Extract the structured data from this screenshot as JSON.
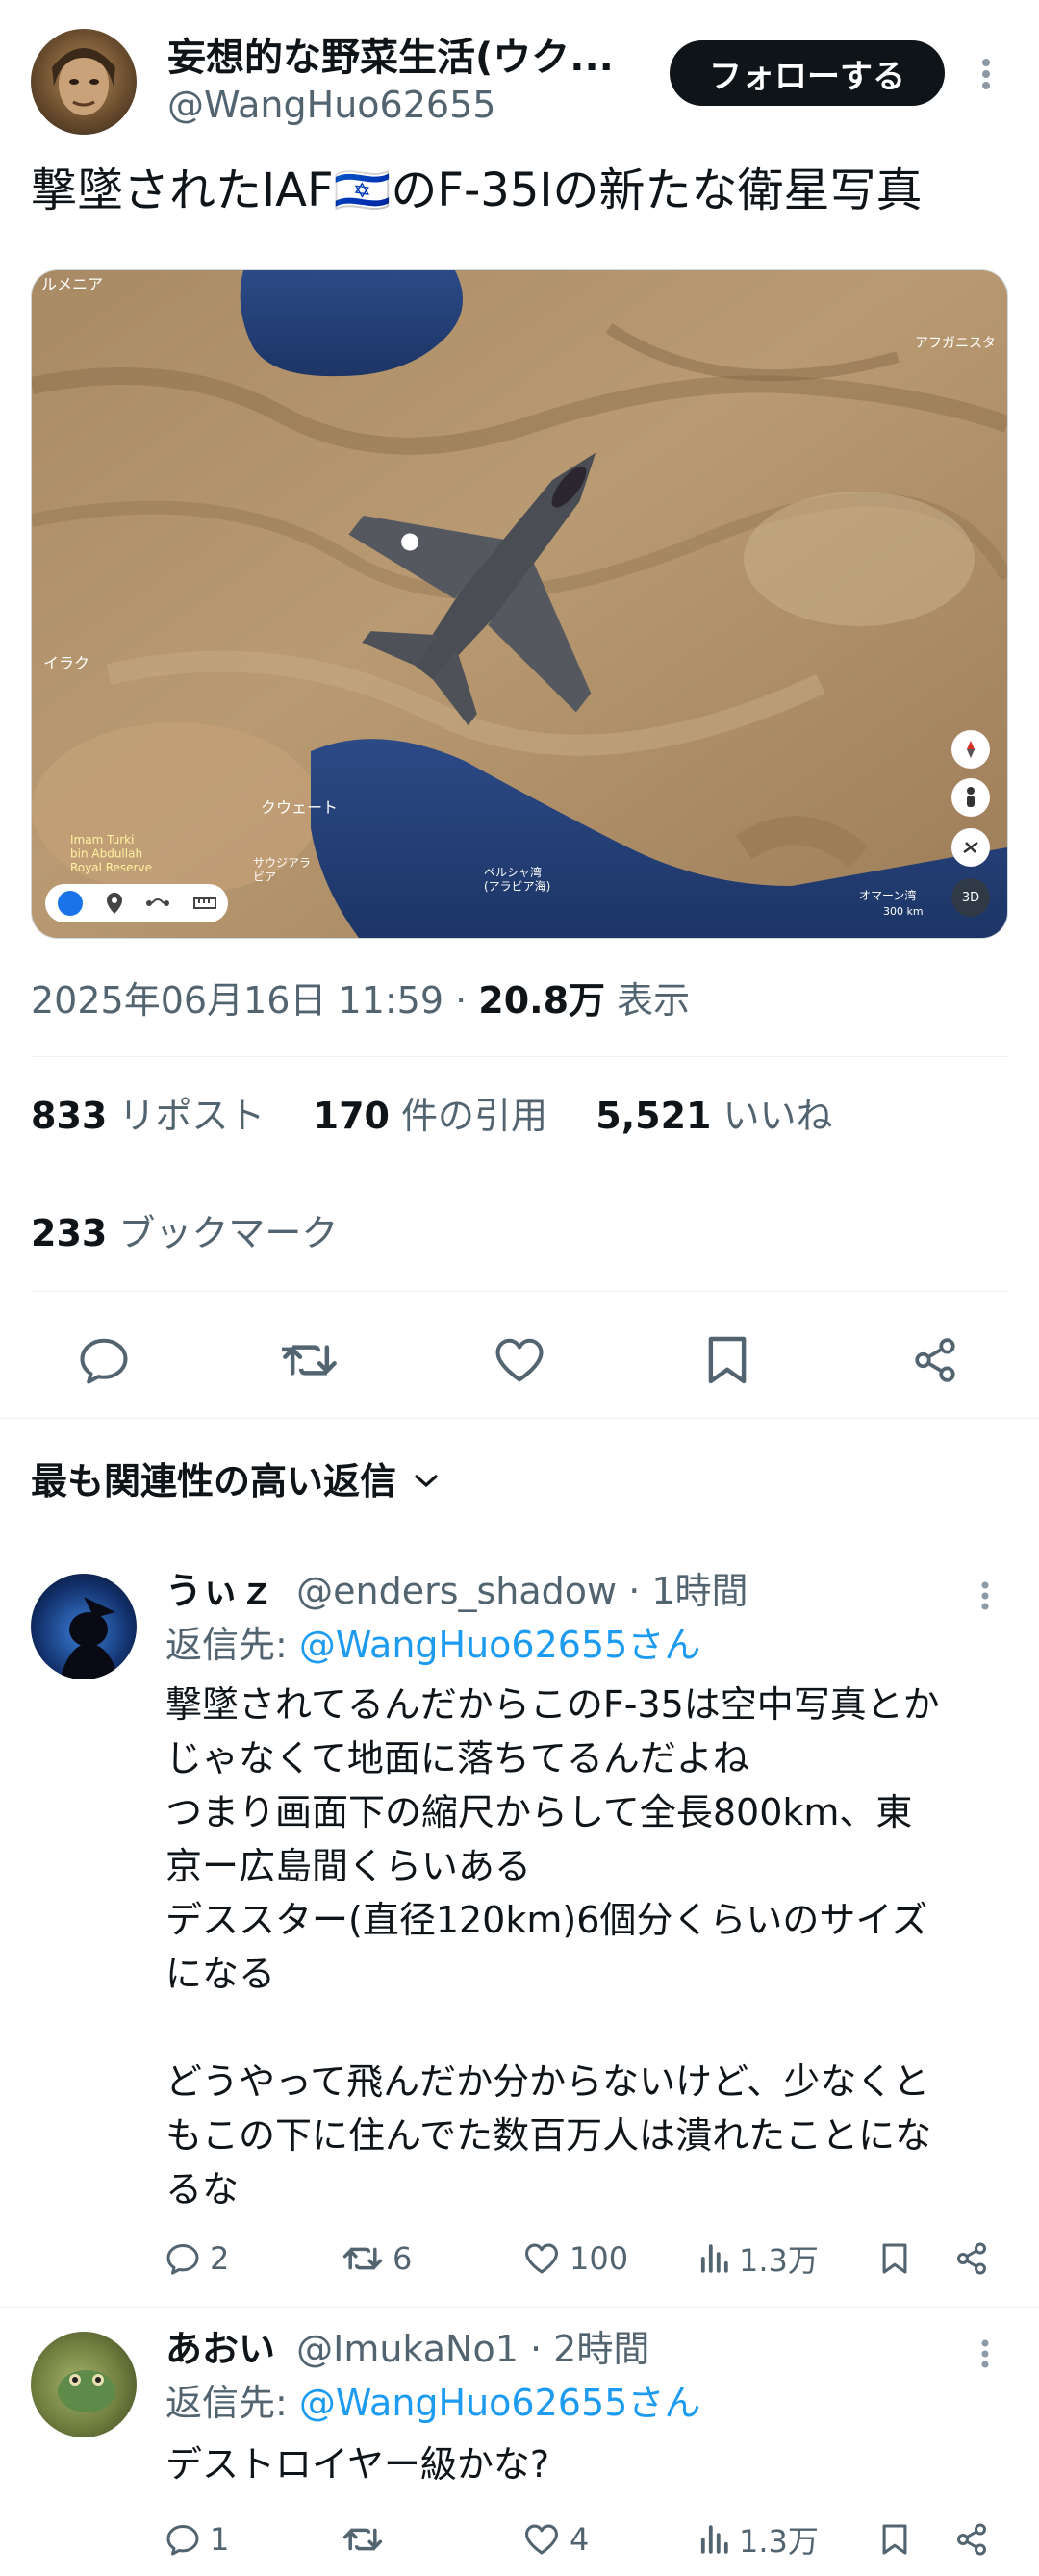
{
  "tweet": {
    "author_name": "妄想的な野菜生活(ウク...",
    "author_handle": "@WangHuo62655",
    "follow_label": "フォローする",
    "text": "撃墜されたIAF🇮🇱のF-35Iの新たな衛星写真",
    "timestamp": "2025年06月16日 11:59",
    "views_count": "20.8万",
    "views_label": "表示",
    "reposts_count": "833",
    "reposts_label": "リポスト",
    "quotes_count": "170",
    "quotes_label": "件の引用",
    "likes_count": "5,521",
    "likes_label": "いいね",
    "bookmarks_count": "233",
    "bookmarks_label": "ブックマーク",
    "map_labels": {
      "armenia": "ルメニア",
      "afghanistan": "アフガニスタ",
      "iraq": "イラク",
      "kuwait": "クウェート",
      "reserve": "Imam Turki\nbin Abdullah\nRoyal Reserve",
      "saudi": "サウジアラ\nビア",
      "gulf": "ペルシャ湾\n(アラビア海)",
      "oman": "オマーン湾",
      "scale": "300 km",
      "view3d": "3D"
    }
  },
  "replies_section": {
    "title": "最も関連性の高い返信"
  },
  "replies": [
    {
      "name": "うぃｚ",
      "handle": "@enders_shadow",
      "time": "· 1時間",
      "reply_to_label": "返信先: ",
      "reply_to_handle": "@WangHuo62655さん",
      "text": "撃墜されてるんだからこのF-35は空中写真とか\nじゃなくて地面に落ちてるんだよね\nつまり画面下の縮尺からして全長800km、東\n京ー広島間くらいある\nデススター(直径120km)6個分くらいのサイズ\nになる\n\nどうやって飛んだか分からないけど、少なくと\nもこの下に住んでた数百万人は潰れたことにな\nるな",
      "comments": "2",
      "reposts": "6",
      "likes": "100",
      "views": "1.3万"
    },
    {
      "name": "あおい",
      "handle": "@ImukaNo1",
      "time": "· 2時間",
      "reply_to_label": "返信先: ",
      "reply_to_handle": "@WangHuo62655さん",
      "text": "デストロイヤー級かな?",
      "comments": "1",
      "reposts": "",
      "likes": "4",
      "views": "1.3万"
    }
  ],
  "colors": {
    "accent": "#1d9bf0",
    "text": "#0f1419",
    "muted": "#536471"
  }
}
